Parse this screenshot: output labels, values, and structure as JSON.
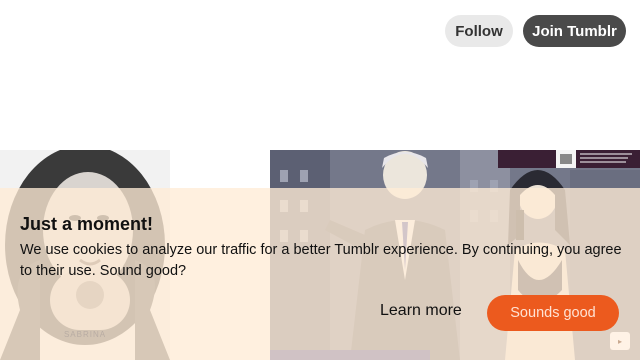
{
  "header": {
    "follow_label": "Follow",
    "join_label": "Join Tumblr"
  },
  "posts": {
    "left_caption": "SABRINA"
  },
  "cookie_banner": {
    "title": "Just a moment!",
    "message": "We use cookies to analyze our traffic for a better Tumblr experience. By continuing, you agree to their use. Sound good?",
    "learn_more_label": "Learn more",
    "accept_label": "Sounds good"
  },
  "colors": {
    "accent": "#ec5a1e",
    "banner_bg": "#ffecd6",
    "join_bg": "#4a4a4a",
    "follow_bg": "#e9e9e9"
  }
}
